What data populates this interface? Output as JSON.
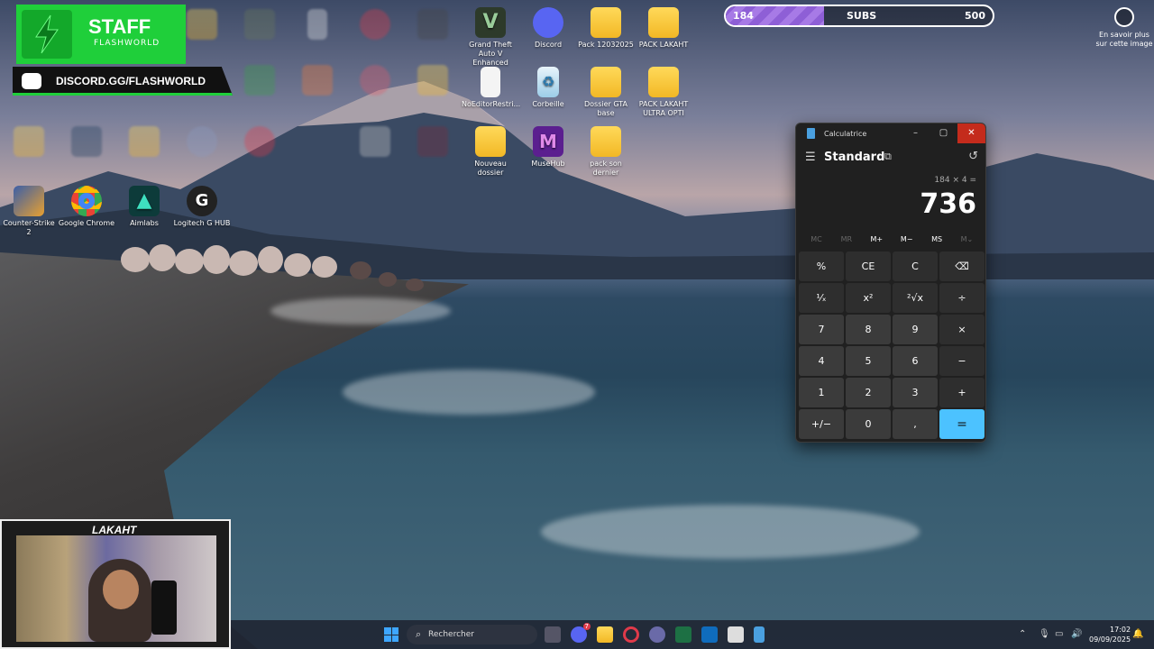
{
  "desktop": {
    "icons": [
      {
        "label": "Grand Theft Auto V Enhanced",
        "icon": "gta-icon"
      },
      {
        "label": "Discord",
        "icon": "discord-icon"
      },
      {
        "label": "Pack 12032025",
        "icon": "folder-icon"
      },
      {
        "label": "PACK LAKAHT",
        "icon": "folder-icon"
      },
      {
        "label": "NoEditorRestri...",
        "icon": "file-icon"
      },
      {
        "label": "Corbeille",
        "icon": "recycle-bin-icon"
      },
      {
        "label": "Dossier GTA base",
        "icon": "folder-icon"
      },
      {
        "label": "PACK LAKAHT ULTRA OPTI",
        "icon": "folder-icon"
      },
      {
        "label": "Nouveau dossier",
        "icon": "folder-icon"
      },
      {
        "label": "MuseHub",
        "icon": "musehub-icon"
      },
      {
        "label": "pack son dernier",
        "icon": "folder-icon"
      },
      {
        "label": "Counter-Strike 2",
        "icon": "cs2-icon"
      },
      {
        "label": "Google Chrome",
        "icon": "chrome-icon"
      },
      {
        "label": "Aimlabs",
        "icon": "aimlabs-icon"
      },
      {
        "label": "Logitech G HUB",
        "icon": "logitech-icon"
      }
    ]
  },
  "overlay": {
    "staff_title": "STAFF",
    "staff_subtitle": "FLASHWORLD",
    "discord_link": "DISCORD.GG/FLASHWORLD",
    "subs": {
      "current": "184",
      "label": "SUBS",
      "goal": "500",
      "progress": 0.368
    },
    "learn_more": "En savoir plus sur cette image",
    "cam_name": "LAKAHT"
  },
  "calculator": {
    "title": "Calculatrice",
    "mode": "Standard",
    "expression": "184 × 4 =",
    "result": "736",
    "memory": [
      "MC",
      "MR",
      "M+",
      "M−",
      "MS",
      "M⌄"
    ],
    "keys": [
      {
        "label": "%",
        "kind": "fn"
      },
      {
        "label": "CE",
        "kind": "fn"
      },
      {
        "label": "C",
        "kind": "fn"
      },
      {
        "label": "⌫",
        "kind": "fn"
      },
      {
        "label": "¹⁄ₓ",
        "kind": "fn"
      },
      {
        "label": "x²",
        "kind": "fn"
      },
      {
        "label": "²√x",
        "kind": "fn"
      },
      {
        "label": "÷",
        "kind": "fn"
      },
      {
        "label": "7",
        "kind": "num"
      },
      {
        "label": "8",
        "kind": "num"
      },
      {
        "label": "9",
        "kind": "num"
      },
      {
        "label": "×",
        "kind": "fn"
      },
      {
        "label": "4",
        "kind": "num"
      },
      {
        "label": "5",
        "kind": "num"
      },
      {
        "label": "6",
        "kind": "num"
      },
      {
        "label": "−",
        "kind": "fn"
      },
      {
        "label": "1",
        "kind": "num"
      },
      {
        "label": "2",
        "kind": "num"
      },
      {
        "label": "3",
        "kind": "num"
      },
      {
        "label": "+",
        "kind": "fn"
      },
      {
        "label": "+/−",
        "kind": "num"
      },
      {
        "label": "0",
        "kind": "num"
      },
      {
        "label": ",",
        "kind": "num"
      },
      {
        "label": "=",
        "kind": "eq"
      }
    ]
  },
  "taskbar": {
    "search_placeholder": "Rechercher",
    "discord_badge": "7",
    "time": "17:02",
    "date": "09/09/2025"
  },
  "colors": {
    "accent": "#4cc2ff",
    "close": "#c42b1c",
    "staff_green": "#1fcf3a",
    "subs_purple": "#8e5fd6"
  }
}
